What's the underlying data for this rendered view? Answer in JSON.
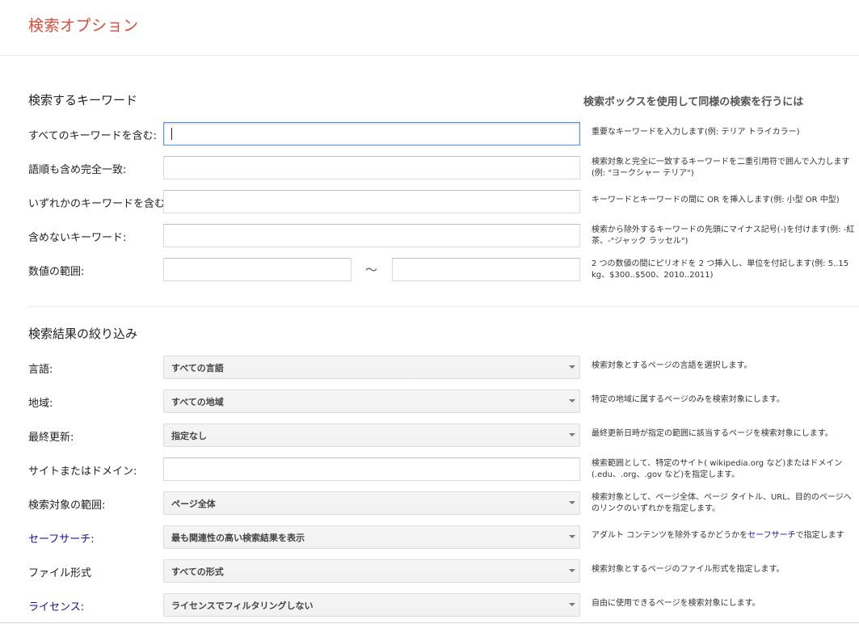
{
  "header": {
    "title": "検索オプション"
  },
  "keywords": {
    "section_title": "検索するキーワード",
    "right_heading": "検索ボックスを使用して同様の検索を行うには",
    "rows": [
      {
        "label": "すべてのキーワードを含む:",
        "value": "",
        "help": "重要なキーワードを入力します(例: テリア トライカラー)"
      },
      {
        "label": "語順も含め完全一致:",
        "value": "",
        "help": "検索対象と完全に一致するキーワードを二重引用符で囲んで入力します(例: \"ヨークシャー テリア\")"
      },
      {
        "label": "いずれかのキーワードを含む:",
        "value": "",
        "help": "キーワードとキーワードの間に OR を挿入します(例: 小型 OR 中型)"
      },
      {
        "label": "含めないキーワード:",
        "value": "",
        "help": "検索から除外するキーワードの先頭にマイナス記号(-)を付けます(例: -紅茶、-\"ジャック ラッセル\")"
      }
    ],
    "range": {
      "label": "数値の範囲:",
      "separator": "〜",
      "from": "",
      "to": "",
      "help": "2 つの数値の間にピリオドを 2 つ挿入し、単位を付記します(例: 5..15 kg、$300..$500、2010..2011)"
    }
  },
  "narrow": {
    "section_title": "検索結果の絞り込み",
    "language": {
      "label": "言語:",
      "value": "すべての言語",
      "help": "検索対象とするページの言語を選択します。"
    },
    "region": {
      "label": "地域:",
      "value": "すべての地域",
      "help": "特定の地域に属するページのみを検索対象にします。"
    },
    "last_update": {
      "label": "最終更新:",
      "value": "指定なし",
      "help": "最終更新日時が指定の範囲に該当するページを検索対象にします。"
    },
    "site": {
      "label": "サイトまたはドメイン:",
      "value": "",
      "help": "検索範囲として、特定のサイト( wikipedia.org など)またはドメイン(.edu、.org、.gov など)を指定します。"
    },
    "terms_appearing": {
      "label": "検索対象の範囲:",
      "value": "ページ全体",
      "help": "検索対象として、ページ全体、ページ タイトル、URL、目的のページへのリンクのいずれかを指定します。"
    },
    "safesearch": {
      "label": "セーフサーチ:",
      "value": "最も関連性の高い検索結果を表示",
      "help_before": "アダルト コンテンツを除外するかどうかを",
      "help_link": "セーフサーチ",
      "help_after": "で指定します"
    },
    "file_type": {
      "label": "ファイル形式",
      "value": "すべての形式",
      "help": "検索対象とするページのファイル形式を指定します。"
    },
    "license": {
      "label": "ライセンス:",
      "value": "ライセンスでフィルタリングしない",
      "help": "自由に使用できるページを検索対象にします。"
    }
  },
  "colors": {
    "title": "#dd4b39",
    "link": "#1a0dab",
    "focus_border": "#4d90fe"
  }
}
